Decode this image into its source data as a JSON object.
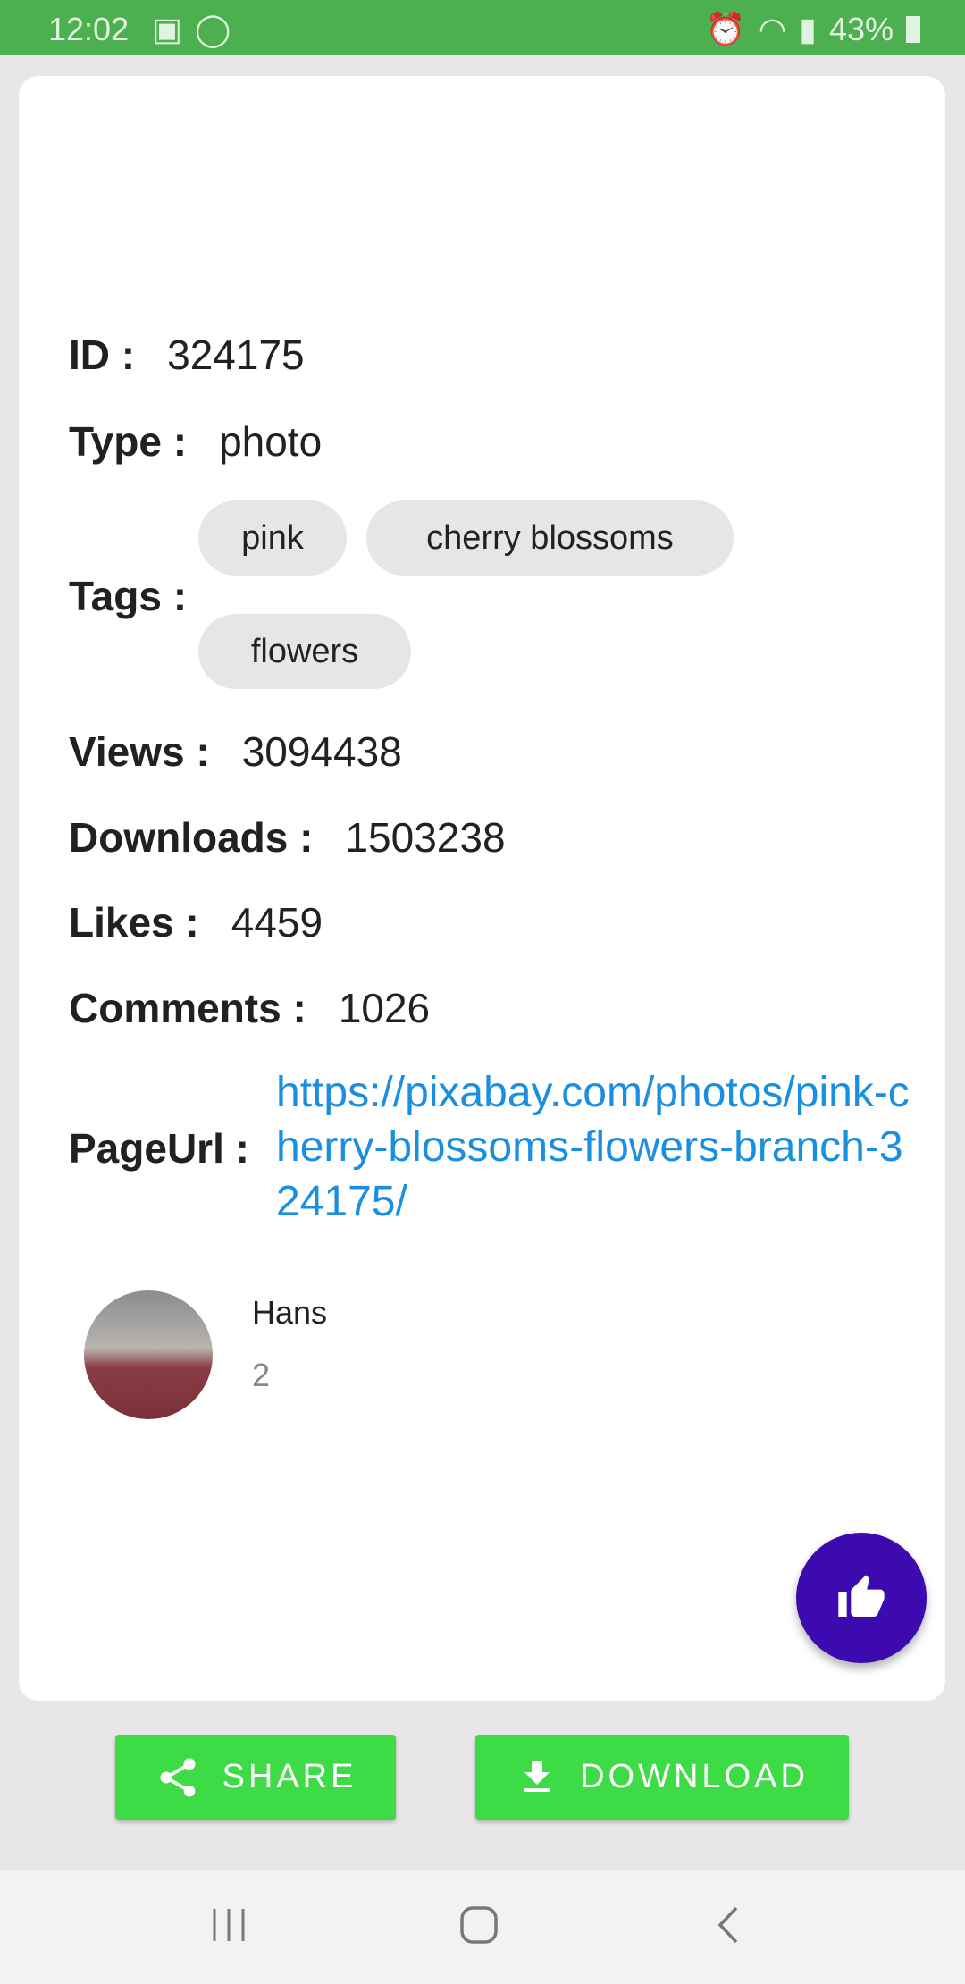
{
  "status_bar": {
    "time": "12:02",
    "battery": "43%"
  },
  "details": {
    "id": {
      "label": "ID :",
      "value": "324175"
    },
    "type": {
      "label": "Type :",
      "value": "photo"
    },
    "tags": {
      "label": "Tags :",
      "items": [
        "pink",
        "cherry blossoms",
        "flowers"
      ]
    },
    "views": {
      "label": "Views :",
      "value": "3094438"
    },
    "downloads": {
      "label": "Downloads :",
      "value": "1503238"
    },
    "likes": {
      "label": "Likes :",
      "value": "4459"
    },
    "comments": {
      "label": "Comments :",
      "value": "1026"
    },
    "page_url": {
      "label": "PageUrl :",
      "value": "https://pixabay.com/photos/pink-cherry-blossoms-flowers-branch-324175/"
    }
  },
  "user": {
    "name": "Hans",
    "count": "2"
  },
  "actions": {
    "share": "SHARE",
    "download": "DOWNLOAD"
  },
  "colors": {
    "status_bar": "#4caf50",
    "fab": "#3d0ab0",
    "buttons": "#3ddc46",
    "link": "#1a8fe0"
  }
}
